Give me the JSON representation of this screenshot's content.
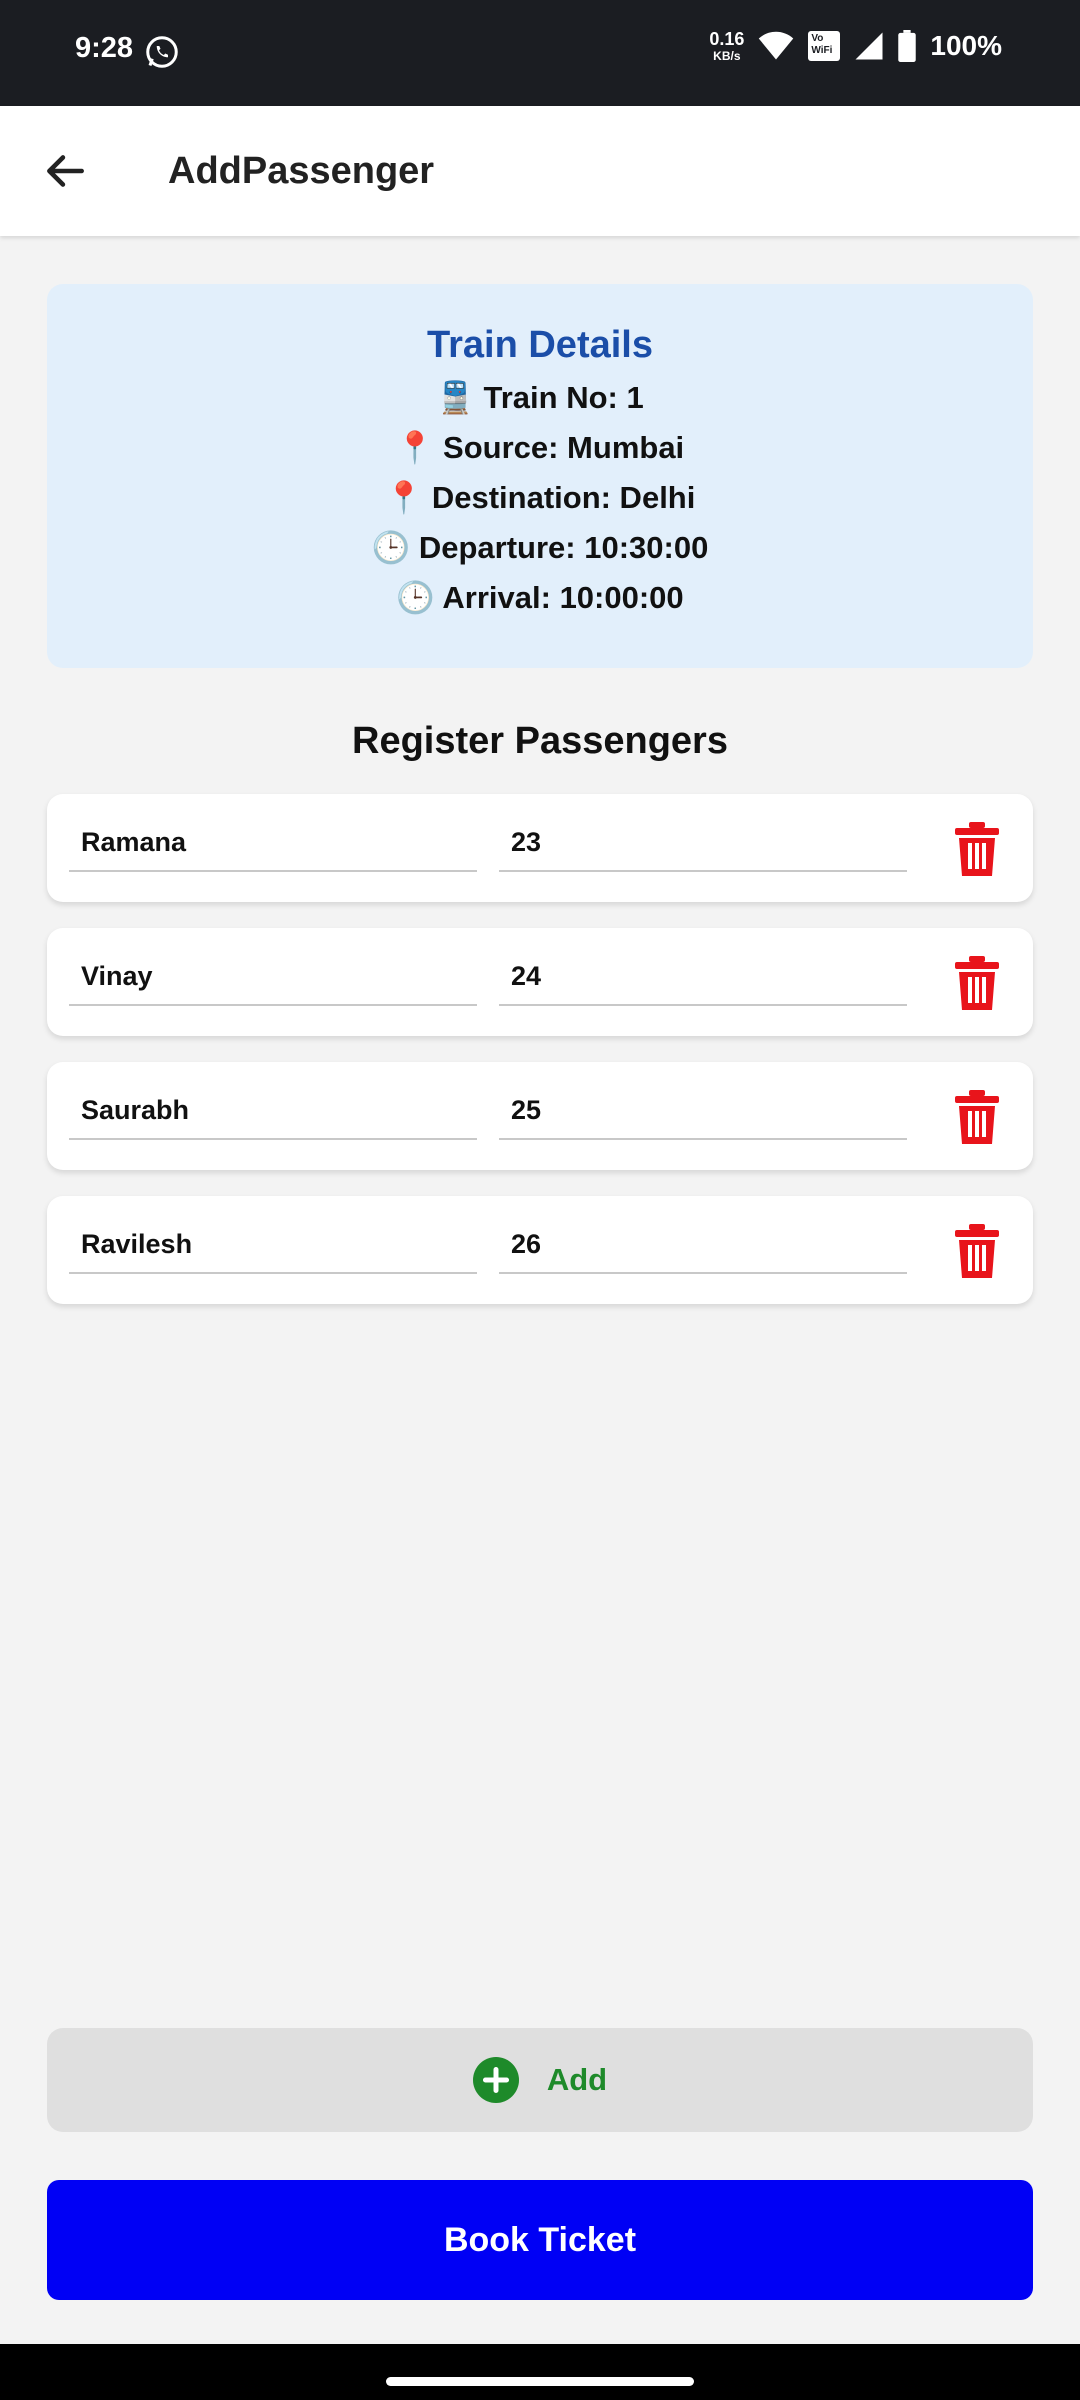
{
  "status_bar": {
    "time": "9:28",
    "net_speed_value": "0.16",
    "net_speed_unit": "KB/s",
    "vowifi_top": "Vo",
    "vowifi_bottom": "WiFi",
    "battery": "100%",
    "icons": [
      "whatsapp-icon",
      "wifi-icon",
      "vowifi-icon",
      "signal-icon",
      "battery-icon"
    ]
  },
  "app_bar": {
    "title": "AddPassenger",
    "back_icon": "arrow-back-icon"
  },
  "train_details": {
    "title": "Train Details",
    "train_no": "🚆 Train No: 1",
    "source": "📍 Source: Mumbai",
    "destination": "📍 Destination: Delhi",
    "departure": "🕒 Departure: 10:30:00",
    "arrival": "🕒 Arrival: 10:00:00"
  },
  "passengers": {
    "title": "Register Passengers",
    "rows": [
      {
        "name": "Ramana",
        "age": "23"
      },
      {
        "name": "Vinay",
        "age": "24"
      },
      {
        "name": "Saurabh",
        "age": "25"
      },
      {
        "name": "Ravilesh",
        "age": "26"
      }
    ],
    "delete_icon": "trash-icon"
  },
  "actions": {
    "add_label": "Add",
    "book_label": "Book Ticket"
  },
  "colors": {
    "status_bar": "#1b1d22",
    "card_bg": "#e2effb",
    "card_title": "#1b4ea8",
    "delete": "#e8141b",
    "add_green": "#1e8a2a",
    "book_blue": "#0000f5"
  }
}
